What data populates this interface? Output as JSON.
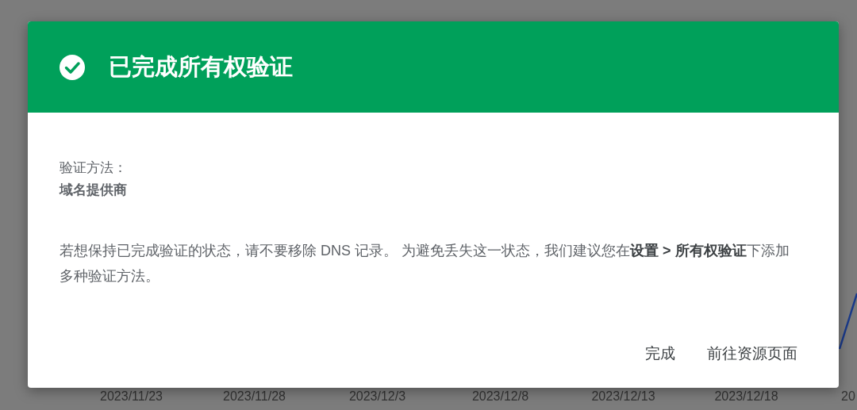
{
  "dialog": {
    "title": "已完成所有权验证",
    "method_label": "验证方法：",
    "method_value": "域名提供商",
    "message": "若想保持已完成验证的状态，请不要移除 DNS 记录。 为避免丢失这一状态，我们建议您在**设置 > 所有权验证**下添加多种验证方法。",
    "buttons": [
      {
        "label": "完成"
      },
      {
        "label": "前往资源页面"
      }
    ]
  },
  "background_chart": {
    "x_labels": [
      "2023/11/23",
      "2023/11/28",
      "2023/12/3",
      "2023/12/8",
      "2023/12/13",
      "2023/12/18",
      "20"
    ]
  }
}
